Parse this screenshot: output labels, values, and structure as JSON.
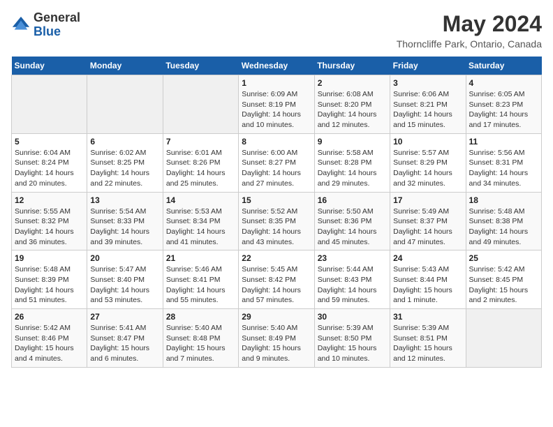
{
  "header": {
    "logo_general": "General",
    "logo_blue": "Blue",
    "title": "May 2024",
    "subtitle": "Thorncliffe Park, Ontario, Canada"
  },
  "days_of_week": [
    "Sunday",
    "Monday",
    "Tuesday",
    "Wednesday",
    "Thursday",
    "Friday",
    "Saturday"
  ],
  "weeks": [
    [
      {
        "day": "",
        "info": ""
      },
      {
        "day": "",
        "info": ""
      },
      {
        "day": "",
        "info": ""
      },
      {
        "day": "1",
        "info": "Sunrise: 6:09 AM\nSunset: 8:19 PM\nDaylight: 14 hours and 10 minutes."
      },
      {
        "day": "2",
        "info": "Sunrise: 6:08 AM\nSunset: 8:20 PM\nDaylight: 14 hours and 12 minutes."
      },
      {
        "day": "3",
        "info": "Sunrise: 6:06 AM\nSunset: 8:21 PM\nDaylight: 14 hours and 15 minutes."
      },
      {
        "day": "4",
        "info": "Sunrise: 6:05 AM\nSunset: 8:23 PM\nDaylight: 14 hours and 17 minutes."
      }
    ],
    [
      {
        "day": "5",
        "info": "Sunrise: 6:04 AM\nSunset: 8:24 PM\nDaylight: 14 hours and 20 minutes."
      },
      {
        "day": "6",
        "info": "Sunrise: 6:02 AM\nSunset: 8:25 PM\nDaylight: 14 hours and 22 minutes."
      },
      {
        "day": "7",
        "info": "Sunrise: 6:01 AM\nSunset: 8:26 PM\nDaylight: 14 hours and 25 minutes."
      },
      {
        "day": "8",
        "info": "Sunrise: 6:00 AM\nSunset: 8:27 PM\nDaylight: 14 hours and 27 minutes."
      },
      {
        "day": "9",
        "info": "Sunrise: 5:58 AM\nSunset: 8:28 PM\nDaylight: 14 hours and 29 minutes."
      },
      {
        "day": "10",
        "info": "Sunrise: 5:57 AM\nSunset: 8:29 PM\nDaylight: 14 hours and 32 minutes."
      },
      {
        "day": "11",
        "info": "Sunrise: 5:56 AM\nSunset: 8:31 PM\nDaylight: 14 hours and 34 minutes."
      }
    ],
    [
      {
        "day": "12",
        "info": "Sunrise: 5:55 AM\nSunset: 8:32 PM\nDaylight: 14 hours and 36 minutes."
      },
      {
        "day": "13",
        "info": "Sunrise: 5:54 AM\nSunset: 8:33 PM\nDaylight: 14 hours and 39 minutes."
      },
      {
        "day": "14",
        "info": "Sunrise: 5:53 AM\nSunset: 8:34 PM\nDaylight: 14 hours and 41 minutes."
      },
      {
        "day": "15",
        "info": "Sunrise: 5:52 AM\nSunset: 8:35 PM\nDaylight: 14 hours and 43 minutes."
      },
      {
        "day": "16",
        "info": "Sunrise: 5:50 AM\nSunset: 8:36 PM\nDaylight: 14 hours and 45 minutes."
      },
      {
        "day": "17",
        "info": "Sunrise: 5:49 AM\nSunset: 8:37 PM\nDaylight: 14 hours and 47 minutes."
      },
      {
        "day": "18",
        "info": "Sunrise: 5:48 AM\nSunset: 8:38 PM\nDaylight: 14 hours and 49 minutes."
      }
    ],
    [
      {
        "day": "19",
        "info": "Sunrise: 5:48 AM\nSunset: 8:39 PM\nDaylight: 14 hours and 51 minutes."
      },
      {
        "day": "20",
        "info": "Sunrise: 5:47 AM\nSunset: 8:40 PM\nDaylight: 14 hours and 53 minutes."
      },
      {
        "day": "21",
        "info": "Sunrise: 5:46 AM\nSunset: 8:41 PM\nDaylight: 14 hours and 55 minutes."
      },
      {
        "day": "22",
        "info": "Sunrise: 5:45 AM\nSunset: 8:42 PM\nDaylight: 14 hours and 57 minutes."
      },
      {
        "day": "23",
        "info": "Sunrise: 5:44 AM\nSunset: 8:43 PM\nDaylight: 14 hours and 59 minutes."
      },
      {
        "day": "24",
        "info": "Sunrise: 5:43 AM\nSunset: 8:44 PM\nDaylight: 15 hours and 1 minute."
      },
      {
        "day": "25",
        "info": "Sunrise: 5:42 AM\nSunset: 8:45 PM\nDaylight: 15 hours and 2 minutes."
      }
    ],
    [
      {
        "day": "26",
        "info": "Sunrise: 5:42 AM\nSunset: 8:46 PM\nDaylight: 15 hours and 4 minutes."
      },
      {
        "day": "27",
        "info": "Sunrise: 5:41 AM\nSunset: 8:47 PM\nDaylight: 15 hours and 6 minutes."
      },
      {
        "day": "28",
        "info": "Sunrise: 5:40 AM\nSunset: 8:48 PM\nDaylight: 15 hours and 7 minutes."
      },
      {
        "day": "29",
        "info": "Sunrise: 5:40 AM\nSunset: 8:49 PM\nDaylight: 15 hours and 9 minutes."
      },
      {
        "day": "30",
        "info": "Sunrise: 5:39 AM\nSunset: 8:50 PM\nDaylight: 15 hours and 10 minutes."
      },
      {
        "day": "31",
        "info": "Sunrise: 5:39 AM\nSunset: 8:51 PM\nDaylight: 15 hours and 12 minutes."
      },
      {
        "day": "",
        "info": ""
      }
    ]
  ]
}
